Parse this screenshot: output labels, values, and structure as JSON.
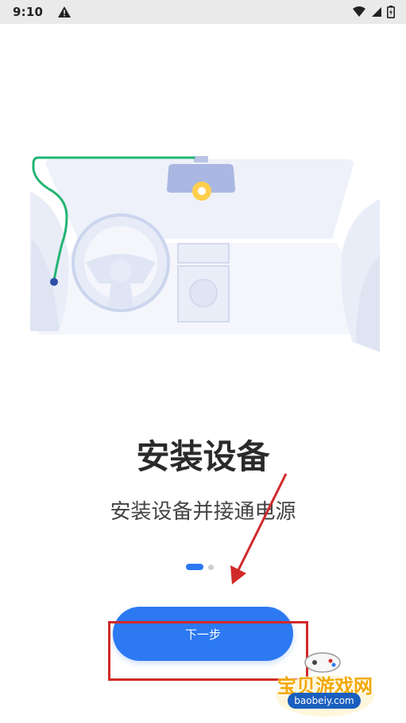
{
  "status_bar": {
    "time": "9:10"
  },
  "main": {
    "title": "安装设备",
    "subtitle": "安装设备并接通电源",
    "pager": {
      "current": 1,
      "total": 2
    }
  },
  "actions": {
    "next_label": "下一步"
  },
  "watermark": {
    "name": "宝贝游戏网",
    "url": "baobeiy.com"
  },
  "colors": {
    "accent": "#2c79f2",
    "cable": "#22b573",
    "annotation": "#d12a2a"
  }
}
